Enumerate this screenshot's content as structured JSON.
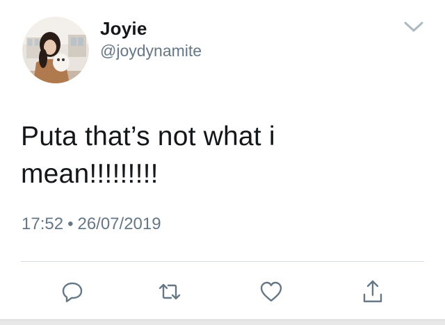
{
  "tweet": {
    "display_name": "Joyie",
    "handle": "@joydynamite",
    "text_line1": "Puta that’s not what i",
    "text_line2": "mean!!!!!!!!!",
    "time": "17:52",
    "separator": "•",
    "date": "26/07/2019"
  },
  "icons": {
    "caret": "chevron-down-icon",
    "reply": "reply-icon",
    "retweet": "retweet-icon",
    "like": "heart-icon",
    "share": "share-icon"
  },
  "colors": {
    "text": "#14171a",
    "secondary": "#657786",
    "divider": "#d6dbdf",
    "icon": "#657786"
  }
}
